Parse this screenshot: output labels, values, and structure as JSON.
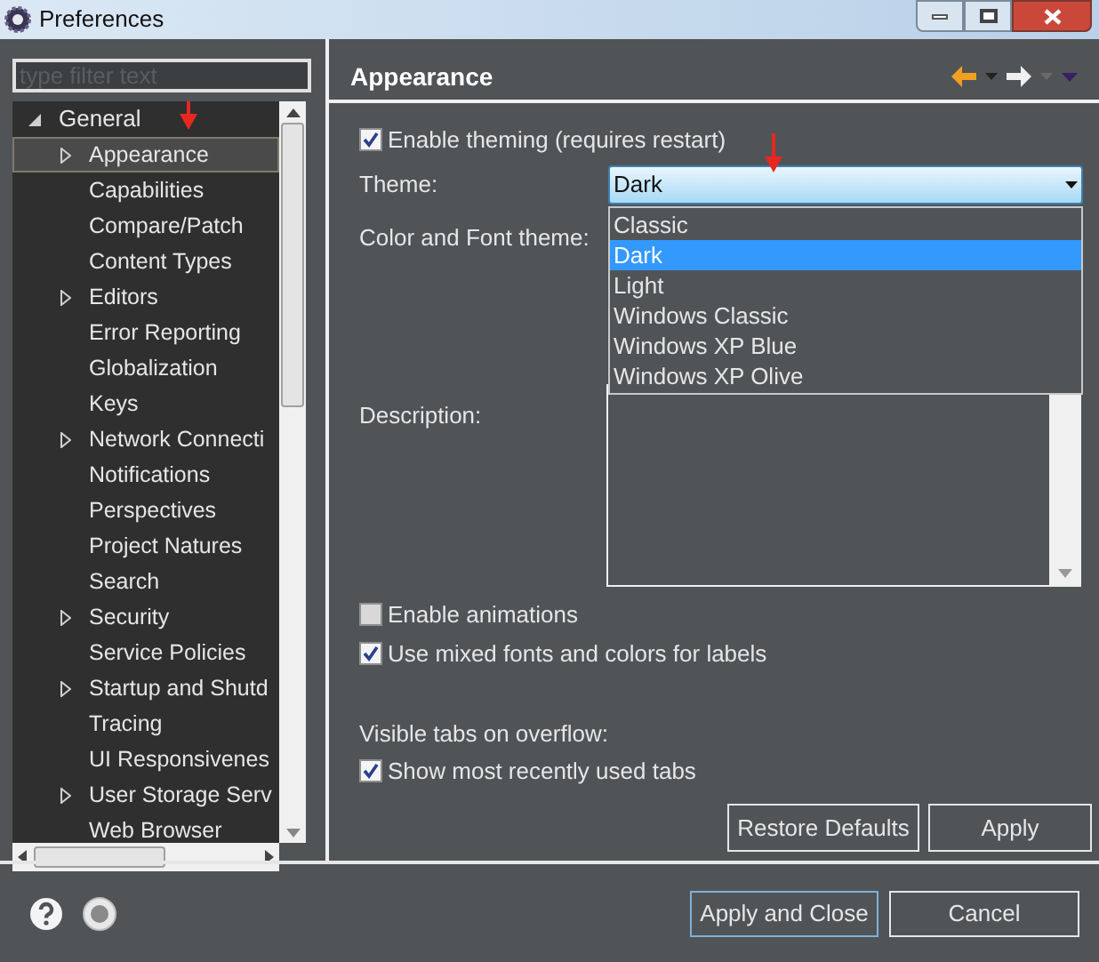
{
  "window": {
    "title": "Preferences"
  },
  "filter": {
    "placeholder": "type filter text"
  },
  "tree": [
    {
      "label": "General",
      "expanded": true,
      "selected": false,
      "children": [
        {
          "label": "Appearance",
          "expandable": true,
          "selected": true
        },
        {
          "label": "Capabilities",
          "expandable": false,
          "selected": false
        },
        {
          "label": "Compare/Patch",
          "expandable": false,
          "selected": false
        },
        {
          "label": "Content Types",
          "expandable": false,
          "selected": false
        },
        {
          "label": "Editors",
          "expandable": true,
          "selected": false
        },
        {
          "label": "Error Reporting",
          "expandable": false,
          "selected": false
        },
        {
          "label": "Globalization",
          "expandable": false,
          "selected": false
        },
        {
          "label": "Keys",
          "expandable": false,
          "selected": false
        },
        {
          "label": "Network Connecti",
          "expandable": true,
          "selected": false
        },
        {
          "label": "Notifications",
          "expandable": false,
          "selected": false
        },
        {
          "label": "Perspectives",
          "expandable": false,
          "selected": false
        },
        {
          "label": "Project Natures",
          "expandable": false,
          "selected": false
        },
        {
          "label": "Search",
          "expandable": false,
          "selected": false
        },
        {
          "label": "Security",
          "expandable": true,
          "selected": false
        },
        {
          "label": "Service Policies",
          "expandable": false,
          "selected": false
        },
        {
          "label": "Startup and Shutd",
          "expandable": true,
          "selected": false
        },
        {
          "label": "Tracing",
          "expandable": false,
          "selected": false
        },
        {
          "label": "UI Responsivenes",
          "expandable": false,
          "selected": false
        },
        {
          "label": "User Storage Serv",
          "expandable": true,
          "selected": false
        },
        {
          "label": "Web Browser",
          "expandable": false,
          "selected": false
        }
      ]
    }
  ],
  "page": {
    "title": "Appearance",
    "enable_theming": {
      "label": "Enable theming (requires restart)",
      "checked": true
    },
    "theme": {
      "label": "Theme:",
      "value": "Dark",
      "options": [
        {
          "label": "Classic",
          "selected": false
        },
        {
          "label": "Dark",
          "selected": true
        },
        {
          "label": "Light",
          "selected": false
        },
        {
          "label": "Windows Classic",
          "selected": false
        },
        {
          "label": "Windows XP Blue",
          "selected": false
        },
        {
          "label": "Windows XP Olive",
          "selected": false
        }
      ]
    },
    "color_font_label": "Color and Font theme:",
    "description_label": "Description:",
    "options": [
      {
        "label": "Enable animations",
        "checked": false
      },
      {
        "label": "Use mixed fonts and colors for labels",
        "checked": true
      }
    ],
    "overflow_label": "Visible tabs on overflow:",
    "overflow_option": {
      "label": "Show most recently used tabs",
      "checked": true
    },
    "buttons": [
      "Restore Defaults",
      "Apply"
    ]
  },
  "footer_buttons": [
    "Apply and Close",
    "Cancel"
  ]
}
